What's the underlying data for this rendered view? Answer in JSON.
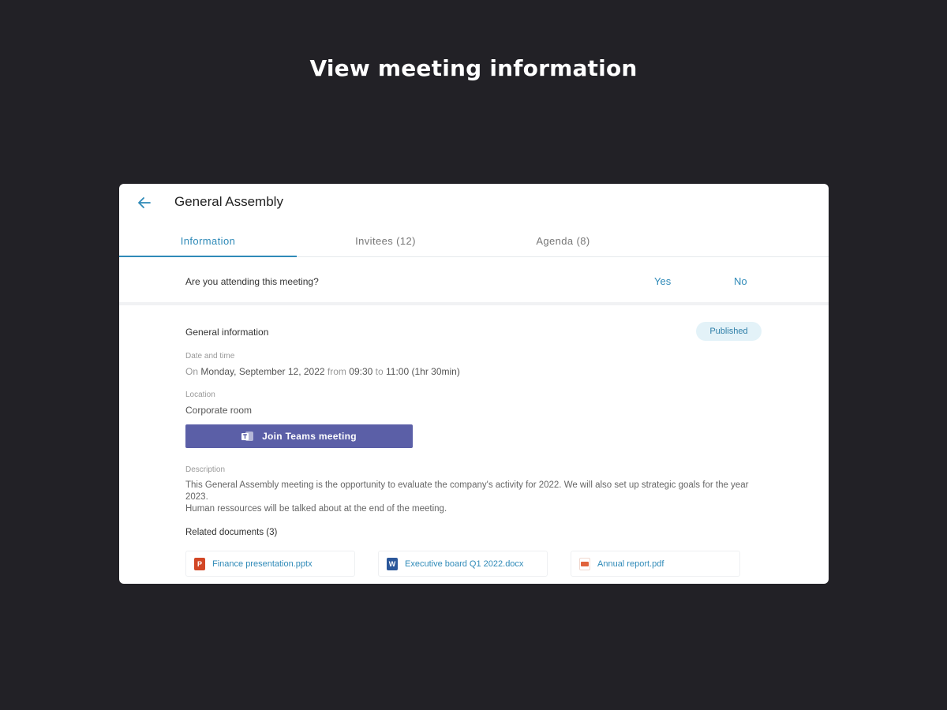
{
  "headline": "View meeting information",
  "meeting": {
    "title": "General Assembly",
    "tabs": [
      {
        "label": "Information",
        "active": true
      },
      {
        "label": "Invitees (12)",
        "active": false
      },
      {
        "label": "Agenda (8)",
        "active": false
      }
    ],
    "attendance": {
      "question": "Are you attending this meeting?",
      "yes_label": "Yes",
      "no_label": "No"
    },
    "general": {
      "section_title": "General information",
      "status_badge": "Published",
      "date_label": "Date and time",
      "date_prefix": "On",
      "date_value": "Monday, September 12, 2022",
      "from_word": "from",
      "start_time": "09:30",
      "to_word": "to",
      "end_time": "11:00",
      "duration": "(1hr 30min)",
      "location_label": "Location",
      "location_value": "Corporate room",
      "join_button": "Join Teams meeting",
      "description_label": "Description",
      "description_line1": "This General Assembly meeting is the opportunity to evaluate the company's activity for 2022. We will also set up strategic goals for the year 2023.",
      "description_line2": "Human ressources will be talked about at the end of the meeting."
    },
    "documents": {
      "title": "Related documents (3)",
      "items": [
        {
          "name": "Finance presentation.pptx",
          "icon": "powerpoint-file-icon",
          "color": "#d24726"
        },
        {
          "name": "Executive board Q1 2022.docx",
          "icon": "word-file-icon",
          "color": "#2b579a"
        },
        {
          "name": "Annual report.pdf",
          "icon": "pdf-file-icon",
          "color": "#e0623b"
        }
      ]
    }
  },
  "colors": {
    "background": "#222126",
    "accent": "#2f8ab8",
    "teams": "#5b5fa7",
    "badge_bg": "#e3f2f8"
  }
}
